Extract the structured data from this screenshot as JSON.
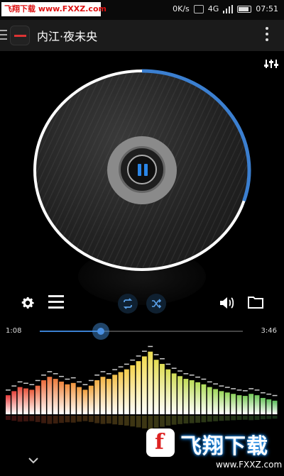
{
  "status_bar": {
    "watermark": "飞翔下载 www.FXXZ.com",
    "net_speed": "0K/s",
    "network": "4G",
    "time": "07:51"
  },
  "app_bar": {
    "title": "内江·夜未央"
  },
  "player": {
    "state": "playing",
    "current_time": "1:08",
    "total_time": "3:46",
    "progress": 0.3,
    "disc_progress": 0.3,
    "accent_color": "#3b7fd0"
  },
  "controls": {
    "icons": [
      "gear-icon",
      "playlist-icon",
      "repeat-icon",
      "shuffle-icon",
      "volume-icon",
      "folder-icon"
    ]
  },
  "visualizer": {
    "levels": [
      0.28,
      0.34,
      0.4,
      0.38,
      0.36,
      0.42,
      0.5,
      0.55,
      0.52,
      0.48,
      0.44,
      0.46,
      0.4,
      0.36,
      0.42,
      0.5,
      0.55,
      0.52,
      0.58,
      0.62,
      0.66,
      0.72,
      0.78,
      0.85,
      0.92,
      0.8,
      0.74,
      0.66,
      0.6,
      0.56,
      0.52,
      0.5,
      0.47,
      0.44,
      0.4,
      0.37,
      0.34,
      0.32,
      0.3,
      0.28,
      0.27,
      0.3,
      0.28,
      0.24,
      0.22,
      0.2
    ]
  },
  "watermark_bottom": {
    "brand": "飞翔下载",
    "url": "www.FXXZ.com"
  }
}
